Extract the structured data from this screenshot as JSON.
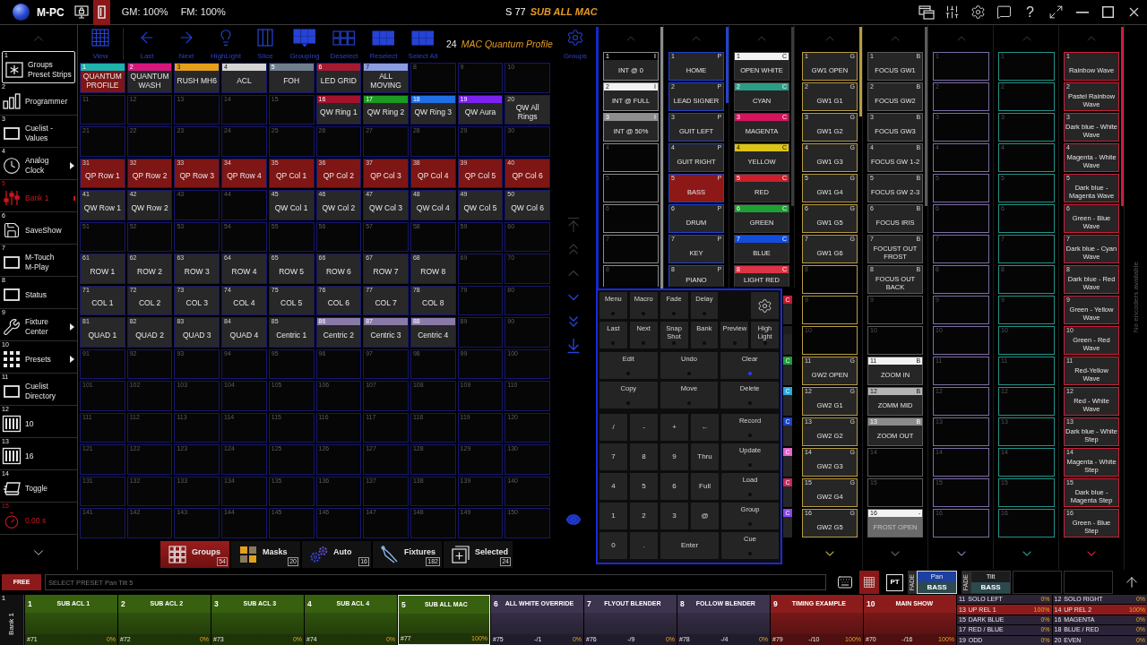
{
  "title_bar": {
    "app_name": "M-PC",
    "door_button": {
      "on": true
    },
    "grand_master": "GM: 100%",
    "flash_master": "FM: 100%",
    "show_step": "S 77",
    "active_cuelist": "SUB ALL MAC",
    "help_label": "?"
  },
  "sidebar": {
    "items": [
      {
        "number": "1",
        "label": "Groups Preset Strips",
        "selected": true,
        "active": false,
        "submenu": false
      },
      {
        "number": "2",
        "label": "Programmer",
        "selected": false,
        "active": false,
        "submenu": false
      },
      {
        "number": "3",
        "label": "Cuelist - Values",
        "selected": false,
        "active": false,
        "submenu": false
      },
      {
        "number": "4",
        "label": "Analog Clock",
        "selected": false,
        "active": false,
        "submenu": true
      },
      {
        "number": "5",
        "label": "Bank 1",
        "selected": false,
        "active": true,
        "submenu": false
      },
      {
        "number": "6",
        "label": "SaveShow",
        "selected": false,
        "active": false,
        "submenu": false
      },
      {
        "number": "7",
        "label": "M-Touch M-Play",
        "selected": false,
        "active": false,
        "submenu": false
      },
      {
        "number": "8",
        "label": "Status",
        "selected": false,
        "active": false,
        "submenu": false
      },
      {
        "number": "9",
        "label": "Fixture Center",
        "selected": false,
        "active": false,
        "submenu": true
      },
      {
        "number": "10",
        "label": "Presets",
        "selected": false,
        "active": false,
        "submenu": true
      },
      {
        "number": "11",
        "label": "Cuelist Directory",
        "selected": false,
        "active": false,
        "submenu": false
      },
      {
        "number": "12",
        "label": "10",
        "selected": false,
        "active": false,
        "submenu": false
      },
      {
        "number": "13",
        "label": "16",
        "selected": false,
        "active": false,
        "submenu": false
      },
      {
        "number": "14",
        "label": "Toggle",
        "selected": false,
        "active": false,
        "submenu": false
      },
      {
        "number": "15",
        "label": "0.00 s",
        "selected": false,
        "active": true,
        "submenu": false
      }
    ]
  },
  "groups_panel": {
    "tools": [
      "View",
      "Last",
      "Next",
      "HighLight",
      "Slice",
      "Grouping",
      "Deselect",
      "Reselect",
      "Select All"
    ],
    "selection_count": "24",
    "selection_name": "MAC Quantum Profile",
    "settings_label": "Groups",
    "cells": [
      {
        "number": "1",
        "label": "QUANTUM PROFILE",
        "color": "#1eb2ac",
        "selected": true
      },
      {
        "number": "2",
        "label": "QUANTUM WASH",
        "color": "#d6187e",
        "selected": false
      },
      {
        "number": "3",
        "label": "RUSH MH6",
        "color": "#e4a01a",
        "selected": false
      },
      {
        "number": "4",
        "label": "ACL",
        "color": "#d4d4d4",
        "selected": false
      },
      {
        "number": "5",
        "label": "FOH",
        "color": "#6e7e8e",
        "selected": false
      },
      {
        "number": "6",
        "label": "LED GRID",
        "color": "#a41a32",
        "selected": false
      },
      {
        "number": "7",
        "label": "ALL MOVING",
        "color": "#8c9ce0",
        "selected": false
      },
      {
        "number": "8",
        "selected": false
      },
      {
        "number": "9",
        "selected": false
      },
      {
        "number": "10",
        "selected": false
      },
      {
        "number": "11",
        "selected": false
      },
      {
        "number": "12",
        "selected": false
      },
      {
        "number": "13",
        "selected": false
      },
      {
        "number": "14",
        "selected": false
      },
      {
        "number": "15",
        "selected": false
      },
      {
        "number": "16",
        "label": "QW Ring 1",
        "color": "#a3122c",
        "selected": false
      },
      {
        "number": "17",
        "label": "QW Ring 2",
        "color": "#1c9a22",
        "selected": false
      },
      {
        "number": "18",
        "label": "QW Ring 3",
        "color": "#2070e4",
        "selected": false
      },
      {
        "number": "19",
        "label": "QW Aura",
        "color": "#7c22f0",
        "selected": false
      },
      {
        "number": "20",
        "label": "QW All Rings",
        "selected": false
      },
      {
        "number": "21",
        "selected": false
      },
      {
        "number": "22",
        "selected": false
      },
      {
        "number": "23",
        "selected": false
      },
      {
        "number": "24",
        "selected": false
      },
      {
        "number": "25",
        "selected": false
      },
      {
        "number": "26",
        "selected": false
      },
      {
        "number": "27",
        "selected": false
      },
      {
        "number": "28",
        "selected": false
      },
      {
        "number": "29",
        "selected": false
      },
      {
        "number": "30",
        "selected": false
      },
      {
        "number": "31",
        "label": "QP Row 1",
        "selected": true
      },
      {
        "number": "32",
        "label": "QP Row 2",
        "selected": true
      },
      {
        "number": "33",
        "label": "QP Row 3",
        "selected": true
      },
      {
        "number": "34",
        "label": "QP Row 4",
        "selected": true
      },
      {
        "number": "35",
        "label": "QP Col 1",
        "selected": true
      },
      {
        "number": "36",
        "label": "QP Col 2",
        "selected": true
      },
      {
        "number": "37",
        "label": "QP Col 3",
        "selected": true
      },
      {
        "number": "38",
        "label": "QP Col 4",
        "selected": true
      },
      {
        "number": "39",
        "label": "QP Col 5",
        "selected": true
      },
      {
        "number": "40",
        "label": "QP Col 6",
        "selected": true
      },
      {
        "number": "41",
        "label": "QW Row 1",
        "selected": false
      },
      {
        "number": "42",
        "label": "QW Row 2",
        "selected": false
      },
      {
        "number": "43",
        "selected": false
      },
      {
        "number": "44",
        "selected": false
      },
      {
        "number": "45",
        "label": "QW Col 1",
        "selected": false
      },
      {
        "number": "46",
        "label": "QW Col 2",
        "selected": false
      },
      {
        "number": "47",
        "label": "QW Col 3",
        "selected": false
      },
      {
        "number": "48",
        "label": "QW Col 4",
        "selected": false
      },
      {
        "number": "49",
        "label": "QW Col 5",
        "selected": false
      },
      {
        "number": "50",
        "label": "QW Col 6",
        "selected": false
      },
      {
        "number": "51",
        "selected": false
      },
      {
        "number": "52",
        "selected": false
      },
      {
        "number": "53",
        "selected": false
      },
      {
        "number": "54",
        "selected": false
      },
      {
        "number": "55",
        "selected": false
      },
      {
        "number": "56",
        "selected": false
      },
      {
        "number": "57",
        "selected": false
      },
      {
        "number": "58",
        "selected": false
      },
      {
        "number": "59",
        "selected": false
      },
      {
        "number": "60",
        "selected": false
      },
      {
        "number": "61",
        "label": "ROW 1",
        "selected": false
      },
      {
        "number": "62",
        "label": "ROW 2",
        "selected": false
      },
      {
        "number": "63",
        "label": "ROW 3",
        "selected": false
      },
      {
        "number": "64",
        "label": "ROW 4",
        "selected": false
      },
      {
        "number": "65",
        "label": "ROW 5",
        "selected": false
      },
      {
        "number": "66",
        "label": "ROW 6",
        "selected": false
      },
      {
        "number": "67",
        "label": "ROW 7",
        "selected": false
      },
      {
        "number": "68",
        "label": "ROW 8",
        "selected": false
      },
      {
        "number": "69",
        "selected": false
      },
      {
        "number": "70",
        "selected": false
      },
      {
        "number": "71",
        "label": "COL 1",
        "selected": false
      },
      {
        "number": "72",
        "label": "COL 2",
        "selected": false
      },
      {
        "number": "73",
        "label": "COL 3",
        "selected": false
      },
      {
        "number": "74",
        "label": "COL 4",
        "selected": false
      },
      {
        "number": "75",
        "label": "COL 5",
        "selected": false
      },
      {
        "number": "76",
        "label": "COL 6",
        "selected": false
      },
      {
        "number": "77",
        "label": "COL 7",
        "selected": false
      },
      {
        "number": "78",
        "label": "COL 8",
        "selected": false
      },
      {
        "number": "79",
        "selected": false
      },
      {
        "number": "80",
        "selected": false
      },
      {
        "number": "81",
        "label": "QUAD 1",
        "selected": false
      },
      {
        "number": "82",
        "label": "QUAD 2",
        "selected": false
      },
      {
        "number": "83",
        "label": "QUAD 3",
        "selected": false
      },
      {
        "number": "84",
        "label": "QUAD 4",
        "selected": false
      },
      {
        "number": "85",
        "label": "Centric 1",
        "selected": false
      },
      {
        "number": "86",
        "label": "Centric 2",
        "color": "#8a7aa8",
        "selected": false
      },
      {
        "number": "87",
        "label": "Centric 3",
        "color": "#8a7aa8",
        "selected": false
      },
      {
        "number": "88",
        "label": "Centric 4",
        "color": "#8a7aa8",
        "selected": false
      },
      {
        "number": "89",
        "selected": false
      },
      {
        "number": "90",
        "selected": false
      },
      {
        "number": "91",
        "selected": false
      },
      {
        "number": "92",
        "selected": false
      },
      {
        "number": "93",
        "selected": false
      },
      {
        "number": "94",
        "selected": false
      },
      {
        "number": "95",
        "selected": false
      },
      {
        "number": "96",
        "selected": false
      },
      {
        "number": "97",
        "selected": false
      },
      {
        "number": "98",
        "selected": false
      },
      {
        "number": "99",
        "selected": false
      },
      {
        "number": "100",
        "selected": false
      },
      {
        "number": "101",
        "selected": false
      },
      {
        "number": "102",
        "selected": false
      },
      {
        "number": "103",
        "selected": false
      },
      {
        "number": "104",
        "selected": false
      },
      {
        "number": "105",
        "selected": false
      },
      {
        "number": "106",
        "selected": false
      },
      {
        "number": "107",
        "selected": false
      },
      {
        "number": "108",
        "selected": false
      },
      {
        "number": "109",
        "selected": false
      },
      {
        "number": "110",
        "selected": false
      },
      {
        "number": "111",
        "selected": false
      },
      {
        "number": "112",
        "selected": false
      },
      {
        "number": "113",
        "selected": false
      },
      {
        "number": "114",
        "selected": false
      },
      {
        "number": "115",
        "selected": false
      },
      {
        "number": "116",
        "selected": false
      },
      {
        "number": "117",
        "selected": false
      },
      {
        "number": "118",
        "selected": false
      },
      {
        "number": "119",
        "selected": false
      },
      {
        "number": "120",
        "selected": false
      },
      {
        "number": "121",
        "selected": false
      },
      {
        "number": "122",
        "selected": false
      },
      {
        "number": "123",
        "selected": false
      },
      {
        "number": "124",
        "selected": false
      },
      {
        "number": "125",
        "selected": false
      },
      {
        "number": "126",
        "selected": false
      },
      {
        "number": "127",
        "selected": false
      },
      {
        "number": "128",
        "selected": false
      },
      {
        "number": "129",
        "selected": false
      },
      {
        "number": "130",
        "selected": false
      },
      {
        "number": "131",
        "selected": false
      },
      {
        "number": "132",
        "selected": false
      },
      {
        "number": "133",
        "selected": false
      },
      {
        "number": "134",
        "selected": false
      },
      {
        "number": "135",
        "selected": false
      },
      {
        "number": "136",
        "selected": false
      },
      {
        "number": "137",
        "selected": false
      },
      {
        "number": "138",
        "selected": false
      },
      {
        "number": "139",
        "selected": false
      },
      {
        "number": "140",
        "selected": false
      },
      {
        "number": "141",
        "selected": false
      },
      {
        "number": "142",
        "selected": false
      },
      {
        "number": "143",
        "selected": false
      },
      {
        "number": "144",
        "selected": false
      },
      {
        "number": "145",
        "selected": false
      },
      {
        "number": "146",
        "selected": false
      },
      {
        "number": "147",
        "selected": false
      },
      {
        "number": "148",
        "selected": false
      },
      {
        "number": "149",
        "selected": false
      },
      {
        "number": "150",
        "selected": false
      }
    ],
    "tabs": [
      {
        "label": "Groups",
        "count": "54",
        "selected": true
      },
      {
        "label": "Masks",
        "count": "20",
        "selected": false
      },
      {
        "label": "Auto",
        "count": "16",
        "selected": false
      },
      {
        "label": "Fixtures",
        "count": "182",
        "selected": false
      },
      {
        "label": "Selected",
        "count": "24",
        "selected": false
      }
    ]
  },
  "preset_strips": [
    {
      "color": "#8c8c8c",
      "items": [
        {
          "number": "1",
          "label": "INT @ 0",
          "color": "#000000",
          "marker": "I",
          "selected": false
        },
        {
          "number": "2",
          "label": "INT @ FULL",
          "color": "#f2f2f2",
          "marker": "I",
          "selected": false
        },
        {
          "number": "3",
          "label": "INT @ 50%",
          "color": "#8e8e8e",
          "marker": "I",
          "selected": false
        },
        {
          "number": "4",
          "selected": false
        },
        {
          "number": "5",
          "selected": false
        },
        {
          "number": "6",
          "selected": false
        },
        {
          "number": "7",
          "selected": false
        },
        {
          "number": "8",
          "selected": false
        }
      ]
    },
    {
      "color": "#2244cc",
      "items": [
        {
          "number": "1",
          "label": "HOME",
          "marker": "P",
          "selected": false
        },
        {
          "number": "2",
          "label": "LEAD SIGNER",
          "marker": "P",
          "selected": false
        },
        {
          "number": "3",
          "label": "GUIT LEFT",
          "marker": "P",
          "selected": false
        },
        {
          "number": "4",
          "label": "GUIT RIGHT",
          "marker": "P",
          "selected": false
        },
        {
          "number": "5",
          "label": "BASS",
          "marker": "P",
          "selected": true
        },
        {
          "number": "6",
          "label": "DRUM",
          "marker": "P",
          "selected": false
        },
        {
          "number": "7",
          "label": "KEY",
          "marker": "P",
          "selected": false
        },
        {
          "number": "8",
          "label": "PIANO",
          "marker": "P",
          "selected": false
        }
      ]
    },
    {
      "color": "#3c3c3c",
      "items": [
        {
          "number": "1",
          "label": "OPEN WHITE",
          "color": "#f2f2f2",
          "marker": "C",
          "selected": false
        },
        {
          "number": "2",
          "label": "CYAN",
          "color": "#2c9c86",
          "marker": "C",
          "selected": false
        },
        {
          "number": "3",
          "label": "MAGENTA",
          "color": "#d4145c",
          "marker": "C",
          "selected": false
        },
        {
          "number": "4",
          "label": "YELLOW",
          "color": "#dcc414",
          "marker": "C",
          "selected": false
        },
        {
          "number": "5",
          "label": "RED",
          "color": "#cc1e2c",
          "marker": "C",
          "selected": false
        },
        {
          "number": "6",
          "label": "GREEN",
          "color": "#1ca034",
          "marker": "C",
          "selected": false
        },
        {
          "number": "7",
          "label": "BLUE",
          "color": "#144cdc",
          "marker": "C",
          "selected": false
        },
        {
          "number": "8",
          "label": "LIGHT RED",
          "color": "#dc3444",
          "marker": "C",
          "selected": false
        },
        {
          "color": "#c41a30",
          "marker": "C",
          "selected": false
        },
        {
          "color": "#1e1e1e",
          "selected": false
        },
        {
          "color": "#1ca034",
          "marker": "C",
          "selected": false
        },
        {
          "color": "#2aa8e0",
          "marker": "C",
          "selected": false
        },
        {
          "color": "#1c44c8",
          "marker": "C",
          "selected": false
        },
        {
          "color": "#e464c8",
          "marker": "C",
          "selected": false
        },
        {
          "color": "#c8285c",
          "marker": "C",
          "selected": false
        },
        {
          "color": "#8848e8",
          "marker": "C",
          "selected": false
        }
      ]
    },
    {
      "color": "#b89c44",
      "items": [
        {
          "number": "1",
          "label": "GW1 OPEN",
          "marker": "G",
          "selected": false
        },
        {
          "number": "2",
          "label": "GW1 G1",
          "marker": "G",
          "selected": false
        },
        {
          "number": "3",
          "label": "GW1 G2",
          "marker": "G",
          "selected": false
        },
        {
          "number": "4",
          "label": "GW1 G3",
          "marker": "G",
          "selected": false
        },
        {
          "number": "5",
          "label": "GW1 G4",
          "marker": "G",
          "selected": false
        },
        {
          "number": "6",
          "label": "GW1 G5",
          "marker": "G",
          "selected": false
        },
        {
          "number": "7",
          "label": "GW1 G6",
          "marker": "G",
          "selected": false
        },
        {
          "number": "8",
          "selected": false
        },
        {
          "number": "9",
          "selected": false
        },
        {
          "number": "10",
          "selected": false
        },
        {
          "number": "11",
          "label": "GW2 OPEN",
          "marker": "G",
          "selected": false
        },
        {
          "number": "12",
          "label": "GW2 G1",
          "marker": "G",
          "selected": false
        },
        {
          "number": "13",
          "label": "GW2 G2",
          "marker": "G",
          "selected": false
        },
        {
          "number": "14",
          "label": "GW2 G3",
          "marker": "G",
          "selected": false
        },
        {
          "number": "15",
          "label": "GW2 G4",
          "marker": "G",
          "selected": false
        },
        {
          "number": "16",
          "label": "GW2 G5",
          "marker": "G",
          "selected": false
        }
      ]
    },
    {
      "color": "#5c5c5c",
      "items": [
        {
          "number": "1",
          "label": "FOCUS GW1",
          "marker": "B",
          "selected": false,
          "disabled": false
        },
        {
          "number": "2",
          "label": "FOCUS GW2",
          "marker": "B",
          "selected": false,
          "disabled": false
        },
        {
          "number": "3",
          "label": "FOCUS GW3",
          "marker": "B",
          "selected": false,
          "disabled": false
        },
        {
          "number": "4",
          "label": "FOCUS GW 1-2",
          "marker": "B",
          "selected": false,
          "disabled": false
        },
        {
          "number": "5",
          "label": "FOCUS GW 2-3",
          "marker": "B",
          "selected": false,
          "disabled": false
        },
        {
          "number": "6",
          "label": "FOCUS IRIS",
          "marker": "B",
          "selected": false,
          "disabled": false
        },
        {
          "number": "7",
          "label": "FOCUST OUT FROST",
          "marker": "B",
          "selected": false,
          "disabled": false
        },
        {
          "number": "8",
          "label": "FOCUS OUT BACK",
          "marker": "B",
          "selected": false,
          "disabled": false
        },
        {
          "number": "9",
          "selected": false,
          "disabled": false
        },
        {
          "number": "10",
          "selected": false,
          "disabled": false
        },
        {
          "number": "11",
          "label": "ZOOM IN",
          "color": "#f2f2f2",
          "marker": "B",
          "selected": false,
          "disabled": false
        },
        {
          "number": "12",
          "label": "ZOMM MID",
          "color": "#b4b4b4",
          "marker": "B",
          "selected": false,
          "disabled": false
        },
        {
          "number": "13",
          "label": "ZOOM OUT",
          "color": "#8c8c8c",
          "marker": "B",
          "selected": false,
          "disabled": false
        },
        {
          "number": "14",
          "selected": false,
          "disabled": false
        },
        {
          "number": "15",
          "selected": false,
          "disabled": false
        },
        {
          "number": "16",
          "label": "FROST OPEN",
          "color": "#f2f2f2",
          "marker": "-",
          "selected": false,
          "disabled": true
        }
      ]
    },
    {
      "color": "#7e6ea6",
      "items": [
        {
          "number": "1",
          "selected": false
        },
        {
          "number": "2",
          "selected": false
        },
        {
          "number": "3",
          "selected": false
        },
        {
          "number": "4",
          "selected": false
        },
        {
          "number": "5",
          "selected": false
        },
        {
          "number": "6",
          "selected": false
        },
        {
          "number": "7",
          "selected": false
        },
        {
          "number": "8",
          "selected": false
        },
        {
          "number": "9",
          "selected": false
        },
        {
          "number": "10",
          "selected": false
        },
        {
          "number": "11",
          "selected": false
        },
        {
          "number": "12",
          "selected": false
        },
        {
          "number": "13",
          "selected": false
        },
        {
          "number": "14",
          "selected": false
        },
        {
          "number": "15",
          "selected": false
        },
        {
          "number": "16",
          "selected": false
        }
      ]
    },
    {
      "color": "#24948a",
      "items": [
        {
          "number": "1",
          "selected": false
        },
        {
          "number": "2",
          "selected": false
        },
        {
          "number": "3",
          "selected": false
        },
        {
          "number": "4",
          "selected": false
        },
        {
          "number": "5",
          "selected": false
        },
        {
          "number": "6",
          "selected": false
        },
        {
          "number": "7",
          "selected": false
        },
        {
          "number": "8",
          "selected": false
        },
        {
          "number": "9",
          "selected": false
        },
        {
          "number": "10",
          "selected": false
        },
        {
          "number": "11",
          "selected": false
        },
        {
          "number": "12",
          "selected": false
        },
        {
          "number": "13",
          "selected": false
        },
        {
          "number": "14",
          "selected": false
        },
        {
          "number": "15",
          "selected": false
        },
        {
          "number": "16",
          "selected": false
        }
      ]
    },
    {
      "color": "#c8203a",
      "items": [
        {
          "number": "1",
          "label": "Rainbow Wave",
          "selected": false
        },
        {
          "number": "2",
          "label": "Pastel Rainbow Wave",
          "selected": false
        },
        {
          "number": "3",
          "label": "Dark blue - White Wave",
          "selected": false
        },
        {
          "number": "4",
          "label": "Magenta - White Wave",
          "selected": false
        },
        {
          "number": "5",
          "label": "Dark blue - Magenta Wave",
          "selected": false
        },
        {
          "number": "6",
          "label": "Green - Blue Wave",
          "selected": false
        },
        {
          "number": "7",
          "label": "Dark blue - Cyan Wave",
          "selected": false
        },
        {
          "number": "8",
          "label": "Dark blue - Red Wave",
          "selected": false
        },
        {
          "number": "9",
          "label": "Green - Yellow Wave",
          "selected": false
        },
        {
          "number": "10",
          "label": "Green - Red Wave",
          "selected": false
        },
        {
          "number": "11",
          "label": "Red-Yellow Wave",
          "selected": false
        },
        {
          "number": "12",
          "label": "Red - White Wave",
          "selected": false
        },
        {
          "number": "13",
          "label": "Dark blue - White Step",
          "selected": false
        },
        {
          "number": "14",
          "label": "Magenta - White Step",
          "selected": false
        },
        {
          "number": "15",
          "label": "Dark blue - Magenta Step",
          "selected": false
        },
        {
          "number": "16",
          "label": "Green - Blue Step",
          "selected": false
        }
      ]
    }
  ],
  "encoder_note": "No encoders available",
  "keypad": {
    "top_keys": [
      {
        "label": "Menu",
        "lit": false
      },
      {
        "label": "Macro",
        "lit": false
      },
      {
        "label": "Fade",
        "lit": false
      },
      {
        "label": "Delay",
        "lit": false
      },
      {
        "label": "Last",
        "lit": false
      },
      {
        "label": "Next",
        "lit": false
      },
      {
        "label": "Snap Shot",
        "lit": false
      },
      {
        "label": "Bank",
        "lit": false
      },
      {
        "label": "Preview",
        "lit": false
      },
      {
        "label": "High Light",
        "lit": false
      }
    ],
    "edit_keys": [
      {
        "label": "Edit",
        "lit": false
      },
      {
        "label": "Undo",
        "lit": false
      },
      {
        "label": "Clear",
        "lit": true
      },
      {
        "label": "Copy",
        "lit": false
      },
      {
        "label": "Move",
        "lit": false
      },
      {
        "label": "Delete",
        "lit": false
      }
    ],
    "number_keys": [
      "/",
      "-",
      "+",
      "←",
      "7",
      "8",
      "9",
      "Thru",
      "4",
      "5",
      "6",
      "Full",
      "1",
      "2",
      "3",
      "@",
      "0",
      ".",
      "Enter"
    ],
    "store_keys": [
      {
        "label": "Record",
        "lit": false
      },
      {
        "label": "Update",
        "lit": false
      },
      {
        "label": "Load",
        "lit": false
      },
      {
        "label": "Group",
        "lit": false
      },
      {
        "label": "Cue",
        "lit": false
      }
    ]
  },
  "command_bar": {
    "free_button": "FREE",
    "command_line": {
      "placeholder": "SELECT PRESET Pan Tilt 5"
    },
    "keyboard_button": {
      "on": false
    },
    "grid_button": {
      "on": true
    },
    "pt_button": "PT",
    "encoders": [
      {
        "fade_label": "FADE",
        "name": "Pan",
        "value": "BASS",
        "selected": true
      },
      {
        "fade_label": "FADE",
        "name": "Tilt",
        "value": "BASS",
        "selected": false
      }
    ]
  },
  "executor_bank": {
    "number": "1",
    "label": "Bank 1",
    "executors": [
      {
        "number": "1",
        "name": "SUB ACL 1",
        "cuelist": "#71",
        "value": "0%",
        "color": "#37600f",
        "selected": false
      },
      {
        "number": "2",
        "name": "SUB ACL 2",
        "cuelist": "#72",
        "value": "0%",
        "color": "#37600f",
        "selected": false
      },
      {
        "number": "3",
        "name": "SUB ACL 3",
        "cuelist": "#73",
        "value": "0%",
        "color": "#37600f",
        "selected": false
      },
      {
        "number": "4",
        "name": "SUB ACL 4",
        "cuelist": "#74",
        "value": "0%",
        "color": "#37600f",
        "selected": false
      },
      {
        "number": "5",
        "name": "SUB ALL MAC",
        "cuelist": "#77",
        "value": "100%",
        "color": "#37600f",
        "selected": true
      },
      {
        "number": "6",
        "name": "ALL WHITE OVERRIDE",
        "cuelist": "#75",
        "step": "-/1",
        "value": "0%",
        "color": "#3d3450",
        "selected": false
      },
      {
        "number": "7",
        "name": "FLYOUT BLENDER",
        "cuelist": "#76",
        "step": "-/9",
        "value": "0%",
        "color": "#3d3450",
        "selected": false
      },
      {
        "number": "8",
        "name": "FOLLOW BLENDER",
        "cuelist": "#78",
        "step": "-/4",
        "value": "0%",
        "color": "#3d3450",
        "selected": false
      },
      {
        "number": "9",
        "name": "TIMING EXAMPLE",
        "cuelist": "#79",
        "step": "-/10",
        "value": "100%",
        "color": "#8c1c1c",
        "selected": false
      },
      {
        "number": "10",
        "name": "MAIN SHOW",
        "cuelist": "#70",
        "step": "-/16",
        "value": "100%",
        "color": "#8c1c1c",
        "selected": false
      }
    ],
    "mini_executors": [
      {
        "number": "11",
        "name": "SOLO LEFT",
        "value": "0%",
        "active": false
      },
      {
        "number": "12",
        "name": "SOLO RIGHT",
        "value": "0%",
        "active": false
      },
      {
        "number": "13",
        "name": "UP REL 1",
        "value": "100%",
        "active": true
      },
      {
        "number": "14",
        "name": "UP REL 2",
        "value": "100%",
        "active": true
      },
      {
        "number": "15",
        "name": "DARK BLUE",
        "value": "0%",
        "active": false
      },
      {
        "number": "16",
        "name": "MAGENTA",
        "value": "0%",
        "active": false
      },
      {
        "number": "17",
        "name": "RED / BLUE",
        "value": "0%",
        "active": false
      },
      {
        "number": "18",
        "name": "BLUE / RED",
        "value": "0%",
        "active": false
      },
      {
        "number": "19",
        "name": "ODD",
        "value": "0%",
        "active": false
      },
      {
        "number": "20",
        "name": "EVEN",
        "value": "0%",
        "active": false
      }
    ]
  }
}
